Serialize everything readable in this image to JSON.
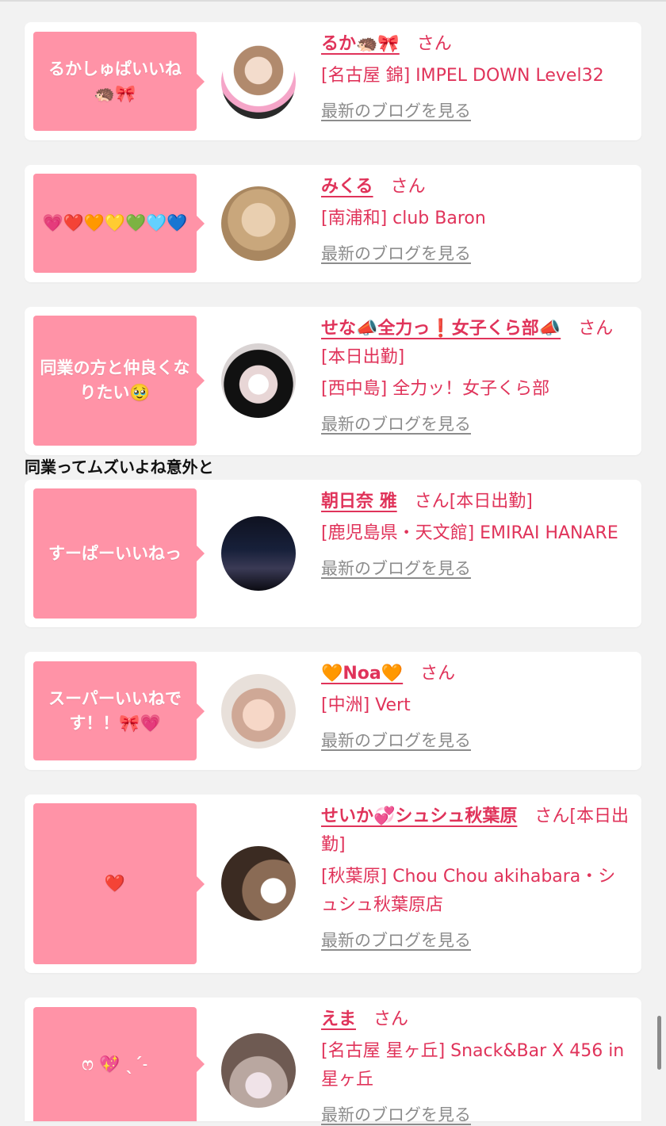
{
  "comment_text": "同業ってムズいよね意外と",
  "blog_link_label": "最新のブログを見る",
  "san_label": "さん",
  "cards": [
    {
      "bubble": "るかしゅぱいいね🦔🎀",
      "name": "るか🦔🎀",
      "suffix": "",
      "shop": "[名古屋 錦] IMPEL DOWN Level32"
    },
    {
      "bubble": "💗❤️🧡💛💚🩵💙",
      "name": "みくる",
      "suffix": "",
      "shop": "[南浦和] club Baron"
    },
    {
      "bubble": "同業の方と仲良くなりたい🥹",
      "name": "せな📣全力っ❗️女子くら部📣",
      "suffix": "[本日出勤]",
      "shop": "[西中島] 全力ッ！女子くら部"
    },
    {
      "bubble": "すーぱーいいねっ",
      "name": "朝日奈 雅",
      "suffix": "[本日出勤]",
      "shop": "[鹿児島県・天文館] EMIRAI HANARE"
    },
    {
      "bubble": "スーパーいいねです！！🎀💗",
      "name": "🧡Noa🧡",
      "suffix": "",
      "shop": "[中洲] Vert"
    },
    {
      "bubble": "❤️",
      "name": "せいか💞シュシュ秋葉原",
      "suffix": "[本日出勤]",
      "shop": "[秋葉原] Chou Chou akihabara・シュシュ秋葉原店"
    },
    {
      "bubble": "ෆ 💖 ˎˊ˗",
      "name": "えま",
      "suffix": "",
      "shop": "[名古屋 星ヶ丘] Snack&Bar X 456 in 星ヶ丘"
    }
  ]
}
